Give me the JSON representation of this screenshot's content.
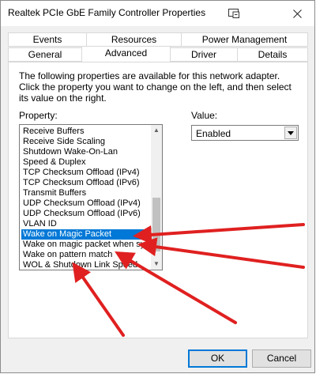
{
  "window": {
    "title": "Realtek PCIe GbE Family Controller Properties"
  },
  "tabs_top": [
    "Events",
    "Resources",
    "Power Management"
  ],
  "tabs_bottom": [
    "General",
    "Advanced",
    "Driver",
    "Details"
  ],
  "active_tab": "Advanced",
  "description": "The following properties are available for this network adapter. Click the property you want to change on the left, and then select its value on the right.",
  "property_label": "Property:",
  "value_label": "Value:",
  "properties": [
    "Receive Buffers",
    "Receive Side Scaling",
    "Shutdown Wake-On-Lan",
    "Speed & Duplex",
    "TCP Checksum Offload (IPv4)",
    "TCP Checksum Offload (IPv6)",
    "Transmit Buffers",
    "UDP Checksum Offload (IPv4)",
    "UDP Checksum Offload (IPv6)",
    "VLAN ID",
    "Wake on Magic Packet",
    "Wake on magic packet when syst",
    "Wake on pattern match",
    "WOL & Shutdown Link Speed"
  ],
  "selected_property": "Wake on Magic Packet",
  "value_selected": "Enabled",
  "buttons": {
    "ok": "OK",
    "cancel": "Cancel"
  },
  "annotation_color": "#e02020",
  "icons": {
    "help": "help-icon",
    "close": "close-icon",
    "scroll_up": "scroll-up-icon",
    "scroll_down": "scroll-down-icon",
    "dropdown": "chevron-down-icon"
  }
}
